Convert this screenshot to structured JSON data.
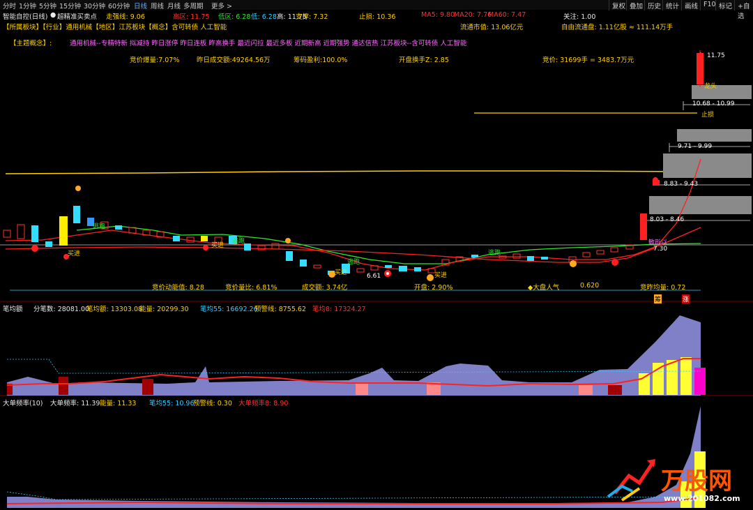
{
  "toolbar": {
    "periods": [
      "分时",
      "1分钟",
      "5分钟",
      "15分钟",
      "30分钟",
      "60分钟",
      "日线",
      "周线",
      "月线",
      "多周期",
      "更多 >"
    ],
    "active_period": "日线",
    "right_buttons": [
      "复权",
      "叠加",
      "历史",
      "统计",
      "画线",
      "F10",
      "标记",
      "+自选"
    ]
  },
  "header": {
    "indicator_name": "智能自控(日线)",
    "formula_name": "超精准买卖点",
    "strength_line": "走强线: 9.06",
    "high_zone": "高区: 11.75",
    "low_zone": "低区: 6.28",
    "low": "低: 6.28",
    "high": "高: 11.75",
    "support": "支撑: 7.32",
    "stop_loss": "止损: 10.36",
    "ma5": "MA5: 9.80",
    "ma20": "MA20: 7.76",
    "ma60": "MA60: 7.47",
    "attention": "关注: 1.00"
  },
  "sectors": {
    "line": "【所属板块】【行业】通用机械【地区】江苏板块【概念】含可转债 人工智能",
    "market_value": "流通市值: 13.06亿元",
    "free_float": "自由流通盘: 1.11亿股 ≈ 111.14万手"
  },
  "themes": {
    "label": "【主题概念】:",
    "text": "通用机械--专精特新 拟减持 昨日涨停 昨日连板 昨高换手 最近闪拉 最近多板 近期新高 近期强势 通达信热 江苏板块--含可转债 人工智能"
  },
  "auction": {
    "volume_burst": "竞价爆量:7.07%",
    "prev_turnover": "昨日成交额:49264.56万",
    "chip_profit": "筹码盈利:100.0%",
    "open_turnover": "开盘换手Z: 2.85",
    "auction_price": "竞价: 31699手 = 3483.7万元"
  },
  "chart_labels": {
    "dragon_head": "龙头",
    "stop_loss": "止损",
    "range1": "10.68 - 10.99",
    "range2": "9.71 - 9.99",
    "range3": "8.83 - 9.43",
    "range4": "8.03 - 8.46",
    "top_price": "11.75",
    "price_low": "6.61",
    "price_now": "7.30",
    "buy_labels": [
      "买进",
      "买进",
      "买进",
      "买进"
    ],
    "follow_labels": [
      "逃跑",
      "逃跑",
      "逃跑",
      "逃跑"
    ],
    "stock_name_tag": "敏形以"
  },
  "stats": {
    "auction_momentum": "竞价动能值: 8.28",
    "auction_vol_ratio": "竞价量比: 6.81%",
    "turnover": "成交额: 3.74亿",
    "open": "开盘: 2.90%",
    "market_pop_label": "◆大盘人气",
    "market_pop": "0.620",
    "prev_auction_avg": "竞昨均量: 0.72",
    "badge1": "筹",
    "badge2": "涨"
  },
  "panel1": {
    "name": "笔均额",
    "count": "分笔数: 28081.00",
    "avg_amount": "笔均额: 13303.08",
    "energy": "能量: 20299.30",
    "avg55": "笔均55: 16692.26",
    "warn": "预警线: 8755.62",
    "avg8": "笔均8: 17324.27"
  },
  "panel2": {
    "name": "大单频率(10)",
    "freq": "大单频率: 11.39",
    "energy": "能量: 11.33",
    "avg55": "笔均55: 10.96",
    "warn": "预警线: 0.30",
    "freq8": "大单频率8: 8.90"
  },
  "watermark": {
    "brand": "万股网",
    "url": "www.201082.com"
  },
  "colors": {
    "up": "#ff3030",
    "down": "#33ddff",
    "ma_yellow": "#ffd000",
    "ma_green": "#2ee62e",
    "ma_red": "#ff2020",
    "purple_area": "#8080c8"
  },
  "chart_data": {
    "type": "candlestick",
    "price_levels": {
      "high": 11.75,
      "low": 6.28,
      "support": 7.32,
      "stop_loss": 10.36,
      "strength_line": 9.06
    },
    "moving_averages": {
      "MA5": 9.8,
      "MA20": 7.76,
      "MA60": 7.47
    },
    "price_zones": [
      [
        10.68,
        10.99
      ],
      [
        9.71,
        9.99
      ],
      [
        8.83,
        9.43
      ],
      [
        8.03,
        8.46
      ]
    ],
    "annotated_prices": [
      6.61,
      7.3,
      11.75
    ]
  }
}
